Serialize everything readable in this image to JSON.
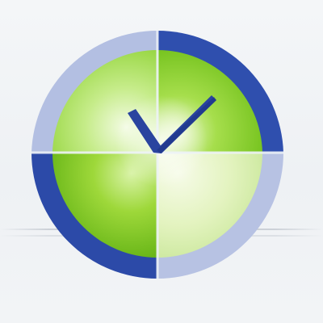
{
  "app_icon": {
    "name": "clock-checkmark-icon",
    "colors": {
      "background": "#f1f3f6",
      "ring_dark_blue": "#2f4fae",
      "ring_light_blue": "#aab6dd",
      "face_green": "#8fd326",
      "face_light": "#e6f5c4",
      "hands": "#253f9a"
    }
  }
}
